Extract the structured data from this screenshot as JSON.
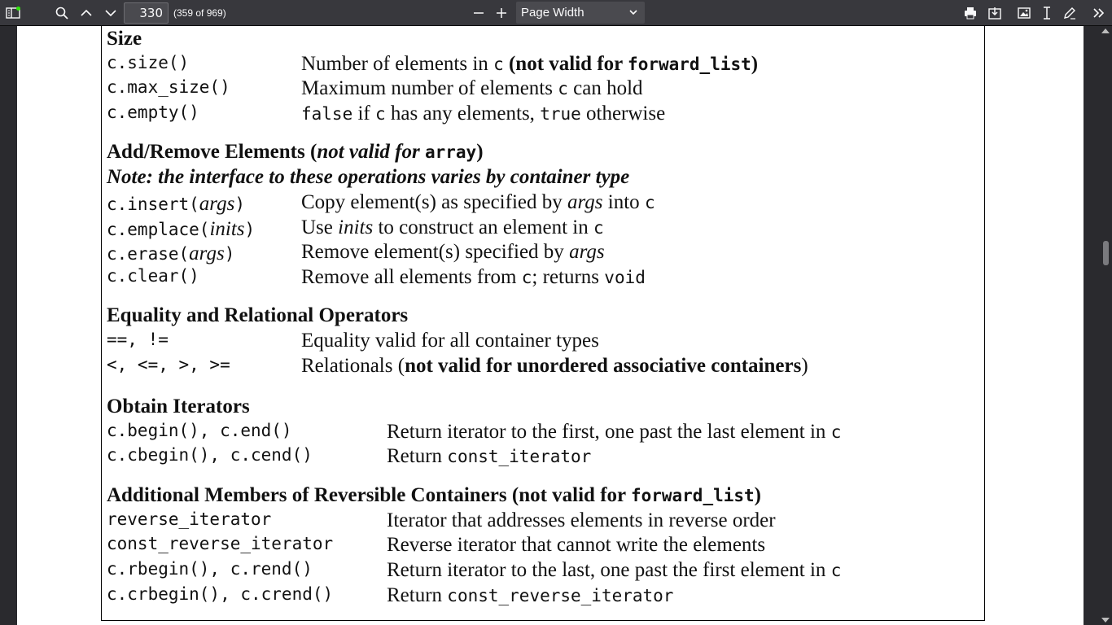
{
  "toolbar": {
    "page_number": "330",
    "page_count": "(359 of 969)",
    "zoom": "Page Width"
  },
  "content": {
    "size": {
      "heading": "Size",
      "rows": [
        {
          "code": "c.size()",
          "d1": "Number of elements in ",
          "d2": "c",
          "d3": " (not valid for ",
          "d4": "forward_list",
          "d5": ")"
        },
        {
          "code": "c.max_size()",
          "d1": "Maximum number of elements ",
          "d2": "c",
          "d3": " can hold"
        },
        {
          "code": "c.empty()",
          "d1": "false",
          "d2": " if ",
          "d3": "c",
          "d4": " has any elements, ",
          "d5": "true",
          "d6": " otherwise"
        }
      ]
    },
    "addremove": {
      "heading_a": "Add/Remove Elements (",
      "heading_b": "not valid for ",
      "heading_c": "array",
      "heading_d": ")",
      "note": "Note: the interface to these operations varies by container type",
      "rows": [
        {
          "code": "c.insert(",
          "arg": "args",
          "close": ")",
          "d1": "Copy element(s) as specified by ",
          "d2": "args",
          "d3": " into ",
          "d4": "c"
        },
        {
          "code": "c.emplace(",
          "arg": "inits",
          "close": ")",
          "d1": "Use ",
          "d2": "inits",
          "d3": " to construct an element in ",
          "d4": "c"
        },
        {
          "code": "c.erase(",
          "arg": "args",
          "close": ")",
          "d1": "Remove element(s) specified by ",
          "d2": "args"
        },
        {
          "code": "c.clear()",
          "d1": "Remove all elements from ",
          "d2": "c",
          "d3": "; returns ",
          "d4": "void"
        }
      ]
    },
    "equality": {
      "heading": "Equality and Relational Operators",
      "rows": [
        {
          "code": "==, !=",
          "d1": "Equality valid for all container types"
        },
        {
          "code": "<, <=, >, >=",
          "d1": "Relationals (",
          "d2": "not valid for unordered associative containers",
          "d3": ")"
        }
      ]
    },
    "iterators": {
      "heading": "Obtain Iterators",
      "rows": [
        {
          "code": "c.begin(), c.end()",
          "d1": "Return iterator to the first, one past the last element in ",
          "d2": "c"
        },
        {
          "code": "c.cbegin(), c.cend()",
          "d1": "Return ",
          "d2": "const_iterator"
        }
      ]
    },
    "reversible": {
      "heading_a": "Additional Members of Reversible Containers (not valid for ",
      "heading_b": "forward_list",
      "heading_c": ")",
      "rows": [
        {
          "code": "reverse_iterator",
          "d1": "Iterator that addresses elements in reverse order"
        },
        {
          "code": "const_reverse_iterator",
          "d1": "Reverse iterator that cannot write the elements"
        },
        {
          "code": "c.rbegin(), c.rend()",
          "d1": "Return iterator to the last, one past the first element in ",
          "d2": "c"
        },
        {
          "code": "c.crbegin(), c.crend()",
          "d1": "Return ",
          "d2": "const_reverse_iterator"
        }
      ]
    }
  }
}
